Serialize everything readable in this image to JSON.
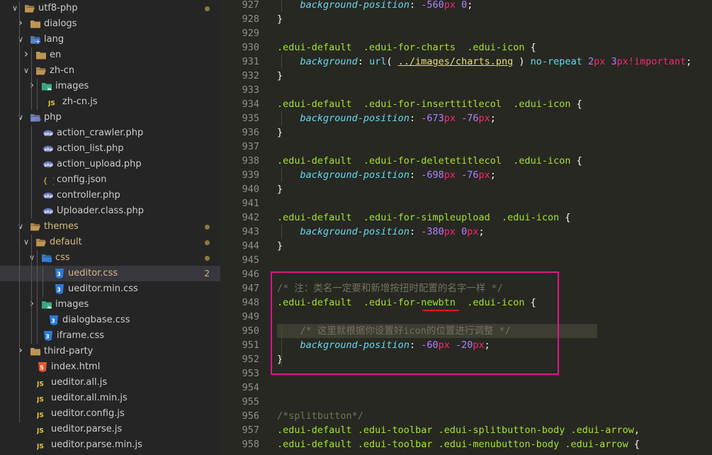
{
  "sidebar": {
    "rows": [
      {
        "label": "utf8-php",
        "icon": "folder-open-icon",
        "chevron": "down",
        "depth": 0,
        "dot": "#8a7a3a"
      },
      {
        "label": "dialogs",
        "icon": "folder-icon",
        "chevron": "right",
        "depth": 1
      },
      {
        "label": "lang",
        "icon": "folder-lang-icon",
        "chevron": "down",
        "depth": 1
      },
      {
        "label": "en",
        "icon": "folder-icon",
        "chevron": "right",
        "depth": 2
      },
      {
        "label": "zh-cn",
        "icon": "folder-open-icon",
        "chevron": "down",
        "depth": 2
      },
      {
        "label": "images",
        "icon": "folder-images-icon",
        "chevron": "right",
        "depth": 3
      },
      {
        "label": "zh-cn.js",
        "icon": "js-file-icon",
        "chevron": "",
        "depth": 3
      },
      {
        "label": "php",
        "icon": "folder-php-icon",
        "chevron": "down",
        "depth": 1
      },
      {
        "label": "action_crawler.php",
        "icon": "php-file-icon",
        "chevron": "",
        "depth": 2
      },
      {
        "label": "action_list.php",
        "icon": "php-file-icon",
        "chevron": "",
        "depth": 2
      },
      {
        "label": "action_upload.php",
        "icon": "php-file-icon",
        "chevron": "",
        "depth": 2
      },
      {
        "label": "config.json",
        "icon": "json-file-icon",
        "chevron": "",
        "depth": 2
      },
      {
        "label": "controller.php",
        "icon": "php-file-icon",
        "chevron": "",
        "depth": 2
      },
      {
        "label": "Uploader.class.php",
        "icon": "php-file-icon",
        "chevron": "",
        "depth": 2
      },
      {
        "label": "themes",
        "icon": "folder-open-icon",
        "chevron": "down",
        "depth": 1,
        "modified": true,
        "dot": "#8a7a3a"
      },
      {
        "label": "default",
        "icon": "folder-open-icon",
        "chevron": "down",
        "depth": 2,
        "modified": true,
        "dot": "#8a7a3a"
      },
      {
        "label": "css",
        "icon": "folder-css-icon",
        "chevron": "down",
        "depth": 3,
        "modified": true,
        "dot": "#8a7a3a"
      },
      {
        "label": "ueditor.css",
        "icon": "css-file-icon",
        "chevron": "",
        "depth": 4,
        "modified": true,
        "selected": true,
        "badge": "2"
      },
      {
        "label": "ueditor.min.css",
        "icon": "css-file-icon",
        "chevron": "",
        "depth": 4
      },
      {
        "label": "images",
        "icon": "folder-images-icon",
        "chevron": "right",
        "depth": 3
      },
      {
        "label": "dialogbase.css",
        "icon": "css-file-icon",
        "chevron": "",
        "depth": 3
      },
      {
        "label": "iframe.css",
        "icon": "css-file-icon",
        "chevron": "",
        "depth": 2
      },
      {
        "label": "third-party",
        "icon": "folder-icon",
        "chevron": "right",
        "depth": 1
      },
      {
        "label": "index.html",
        "icon": "html-file-icon",
        "chevron": "",
        "depth": 1
      },
      {
        "label": "ueditor.all.js",
        "icon": "js-file-icon",
        "chevron": "",
        "depth": 1
      },
      {
        "label": "ueditor.all.min.js",
        "icon": "js-file-icon",
        "chevron": "",
        "depth": 1
      },
      {
        "label": "ueditor.config.js",
        "icon": "js-file-icon",
        "chevron": "",
        "depth": 1
      },
      {
        "label": "ueditor.parse.js",
        "icon": "js-file-icon",
        "chevron": "",
        "depth": 1
      },
      {
        "label": "ueditor.parse.min.js",
        "icon": "js-file-icon",
        "chevron": "",
        "depth": 1
      }
    ]
  },
  "editor": {
    "lines": [
      {
        "n": "927",
        "parts": [
          [
            "    ",
            ""
          ],
          [
            "background-position",
            "prop"
          ],
          [
            ": ",
            ""
          ],
          [
            "-560",
            "num"
          ],
          [
            "px",
            "unit"
          ],
          [
            " ",
            ""
          ],
          [
            "0",
            "num"
          ],
          [
            ";",
            ""
          ]
        ]
      },
      {
        "n": "928",
        "parts": [
          [
            "}",
            ""
          ]
        ]
      },
      {
        "n": "929",
        "parts": []
      },
      {
        "n": "930",
        "parts": [
          [
            ".edui-default  .edui-for-charts  .edui-icon",
            "sel-c"
          ],
          [
            " {",
            ""
          ]
        ]
      },
      {
        "n": "931",
        "parts": [
          [
            "    ",
            ""
          ],
          [
            "background",
            "prop"
          ],
          [
            ": ",
            ""
          ],
          [
            "url",
            "kw"
          ],
          [
            "( ",
            ""
          ],
          [
            "../images/charts.png",
            "url"
          ],
          [
            " ) ",
            ""
          ],
          [
            "no-repeat",
            "kw"
          ],
          [
            " ",
            ""
          ],
          [
            "2",
            "num"
          ],
          [
            "px",
            "unit"
          ],
          [
            " ",
            ""
          ],
          [
            "3",
            "num"
          ],
          [
            "px",
            "unit"
          ],
          [
            "!important",
            "imp"
          ],
          [
            ";",
            ""
          ]
        ]
      },
      {
        "n": "932",
        "parts": [
          [
            "}",
            ""
          ]
        ]
      },
      {
        "n": "933",
        "parts": []
      },
      {
        "n": "934",
        "parts": [
          [
            ".edui-default  .edui-for-inserttitlecol  .edui-icon",
            "sel-c"
          ],
          [
            " {",
            ""
          ]
        ]
      },
      {
        "n": "935",
        "parts": [
          [
            "    ",
            ""
          ],
          [
            "background-position",
            "prop"
          ],
          [
            ": ",
            ""
          ],
          [
            "-673",
            "num"
          ],
          [
            "px",
            "unit"
          ],
          [
            " ",
            ""
          ],
          [
            "-76",
            "num"
          ],
          [
            "px",
            "unit"
          ],
          [
            ";",
            ""
          ]
        ]
      },
      {
        "n": "936",
        "parts": [
          [
            "}",
            ""
          ]
        ]
      },
      {
        "n": "937",
        "parts": []
      },
      {
        "n": "938",
        "parts": [
          [
            ".edui-default  .edui-for-deletetitlecol  .edui-icon",
            "sel-c"
          ],
          [
            " {",
            ""
          ]
        ]
      },
      {
        "n": "939",
        "parts": [
          [
            "    ",
            ""
          ],
          [
            "background-position",
            "prop"
          ],
          [
            ": ",
            ""
          ],
          [
            "-698",
            "num"
          ],
          [
            "px",
            "unit"
          ],
          [
            " ",
            ""
          ],
          [
            "-76",
            "num"
          ],
          [
            "px",
            "unit"
          ],
          [
            ";",
            ""
          ]
        ]
      },
      {
        "n": "940",
        "parts": [
          [
            "}",
            ""
          ]
        ]
      },
      {
        "n": "941",
        "parts": []
      },
      {
        "n": "942",
        "parts": [
          [
            ".edui-default  .edui-for-simpleupload  .edui-icon",
            "sel-c"
          ],
          [
            " {",
            ""
          ]
        ]
      },
      {
        "n": "943",
        "parts": [
          [
            "    ",
            ""
          ],
          [
            "background-position",
            "prop"
          ],
          [
            ": ",
            ""
          ],
          [
            "-380",
            "num"
          ],
          [
            "px",
            "unit"
          ],
          [
            " ",
            ""
          ],
          [
            "0",
            "num"
          ],
          [
            "px",
            "unit"
          ],
          [
            ";",
            ""
          ]
        ]
      },
      {
        "n": "944",
        "parts": [
          [
            "}",
            ""
          ]
        ]
      },
      {
        "n": "945",
        "parts": []
      },
      {
        "n": "946",
        "parts": []
      },
      {
        "n": "947",
        "parts": [
          [
            "/* 注：类名一定要和新增按扭时配置的名字一样 */",
            "cmt"
          ]
        ]
      },
      {
        "n": "948",
        "parts": [
          [
            ".edui-default  .edui-for-newbtn  .edui-icon",
            "sel-c"
          ],
          [
            " {",
            ""
          ]
        ]
      },
      {
        "n": "949",
        "parts": []
      },
      {
        "n": "950",
        "parts": [
          [
            "    ",
            ""
          ],
          [
            "/* 这里就根据你设置好icon的位置进行调整 */",
            "cmt"
          ]
        ],
        "highlight": true
      },
      {
        "n": "951",
        "parts": [
          [
            "    ",
            ""
          ],
          [
            "background-position",
            "prop"
          ],
          [
            ": ",
            ""
          ],
          [
            "-60",
            "num"
          ],
          [
            "px",
            "unit"
          ],
          [
            " ",
            ""
          ],
          [
            "-20",
            "num"
          ],
          [
            "px",
            "unit"
          ],
          [
            ";",
            ""
          ]
        ]
      },
      {
        "n": "952",
        "parts": [
          [
            "}",
            ""
          ]
        ]
      },
      {
        "n": "953",
        "parts": []
      },
      {
        "n": "954",
        "parts": []
      },
      {
        "n": "955",
        "parts": []
      },
      {
        "n": "956",
        "parts": [
          [
            "/*splitbutton*/",
            "cmt"
          ]
        ]
      },
      {
        "n": "957",
        "parts": [
          [
            ".edui-default .edui-toolbar .edui-splitbutton-body .edui-arrow",
            "sel-c"
          ],
          [
            ",",
            ""
          ]
        ]
      },
      {
        "n": "958",
        "parts": [
          [
            ".edui-default .edui-toolbar .edui-menubutton-body .edui-arrow",
            "sel-c"
          ],
          [
            " {",
            ""
          ]
        ]
      }
    ]
  },
  "colors": {
    "annotation_box": "#e0148c",
    "underline": "#e0141c"
  }
}
